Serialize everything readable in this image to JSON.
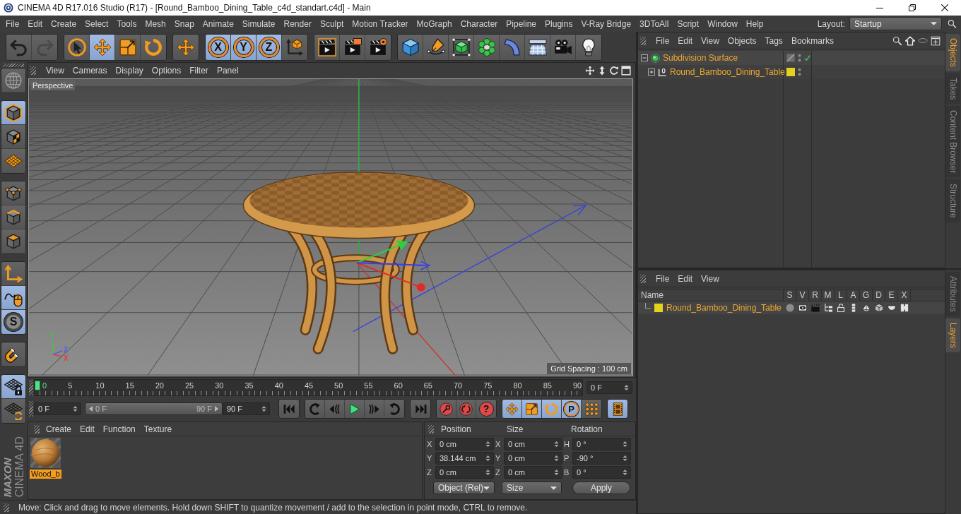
{
  "window": {
    "title": "CINEMA 4D R17.016 Studio (R17) - [Round_Bamboo_Dining_Table_c4d_standart.c4d] - Main"
  },
  "menubar": {
    "items": [
      "File",
      "Edit",
      "Create",
      "Select",
      "Tools",
      "Mesh",
      "Snap",
      "Animate",
      "Simulate",
      "Render",
      "Sculpt",
      "Motion Tracker",
      "MoGraph",
      "Character",
      "Pipeline",
      "Plugins",
      "V-Ray Bridge",
      "3DToAll",
      "Script",
      "Window",
      "Help"
    ],
    "layout_label": "Layout:",
    "layout_value": "Startup"
  },
  "toolbar": {
    "groups": [
      [
        {
          "on": false,
          "disabled": false
        },
        {
          "on": false,
          "disabled": true
        }
      ],
      [
        {
          "on": false,
          "disabled": false
        },
        {
          "on": true,
          "disabled": false
        },
        {
          "on": false,
          "disabled": false
        },
        {
          "on": false,
          "disabled": false
        }
      ],
      [
        {
          "on": false,
          "disabled": false
        }
      ],
      [
        {
          "label": "X",
          "on": true,
          "disabled": false
        },
        {
          "label": "Y",
          "on": true,
          "disabled": false
        },
        {
          "label": "Z",
          "on": true,
          "disabled": false
        },
        {
          "on": false,
          "disabled": false
        }
      ],
      [
        {
          "on": false,
          "disabled": false
        },
        {
          "on": false,
          "disabled": false
        },
        {
          "on": false,
          "disabled": false
        }
      ],
      [
        {
          "on": false,
          "disabled": false
        },
        {
          "on": false,
          "disabled": false
        },
        {
          "on": false,
          "disabled": false
        },
        {
          "on": false,
          "disabled": false
        },
        {
          "on": false,
          "disabled": false
        },
        {
          "on": false,
          "disabled": false
        },
        {
          "on": false,
          "disabled": false
        },
        {
          "on": false,
          "disabled": false
        }
      ]
    ]
  },
  "tool_strip": {
    "groups": [
      [
        {
          "on": false
        }
      ],
      [
        {
          "on": true
        },
        {
          "on": false
        },
        {
          "on": false
        }
      ],
      [
        {
          "on": false
        },
        {
          "on": false
        },
        {
          "on": false
        }
      ],
      [
        {
          "on": false
        },
        {
          "on": true
        },
        {
          "label": "S",
          "on": true
        }
      ],
      [
        {
          "on": false
        }
      ],
      [
        {
          "on": true
        },
        {
          "on": false
        }
      ]
    ]
  },
  "viewport": {
    "menu": [
      "View",
      "Cameras",
      "Display",
      "Options",
      "Filter",
      "Panel"
    ],
    "camera": "Perspective",
    "grid_spacing": "Grid Spacing : 100 cm",
    "axis_labels": [
      {
        "label": "Y",
        "color": "#3cc83c"
      },
      {
        "label": "Z",
        "color": "#4d5cf2"
      },
      {
        "label": "X",
        "color": "#e04040"
      }
    ]
  },
  "timeline": {
    "labels": [
      "0",
      "5",
      "10",
      "15",
      "20",
      "25",
      "30",
      "35",
      "40",
      "45",
      "50",
      "55",
      "60",
      "65",
      "70",
      "75",
      "80",
      "85",
      "90"
    ],
    "level": 0,
    "current_frame": "0 F"
  },
  "transport": {
    "start_field": "0 F",
    "range": {
      "start": "0 F",
      "end": "90 F",
      "level": 1
    },
    "end_field": "90 F",
    "groups": [
      [
        {
          "on": false
        }
      ],
      [
        {
          "on": false
        },
        {
          "on": false
        },
        {
          "on": false
        },
        {
          "on": false
        },
        {
          "on": false
        }
      ],
      [
        {
          "on": false
        }
      ],
      [
        {
          "on": false
        },
        {
          "on": false
        },
        {
          "label": "?",
          "on": false
        }
      ],
      [
        {
          "on": true
        },
        {
          "on": true
        },
        {
          "on": true
        },
        {
          "label": "P",
          "on": true
        },
        {
          "on": false
        }
      ],
      [
        {
          "on": true
        }
      ]
    ]
  },
  "material_manager": {
    "menu": [
      "Create",
      "Edit",
      "Function",
      "Texture"
    ],
    "materials": [
      {
        "name": "Wood_b",
        "selected": true
      }
    ]
  },
  "coordinates": {
    "headers": [
      "Position",
      "Size",
      "Rotation"
    ],
    "rows": [
      [
        {
          "axis": "X",
          "value": "0 cm"
        },
        {
          "axis": "X",
          "value": "0 cm"
        },
        {
          "axis": "H",
          "value": "0 °"
        }
      ],
      [
        {
          "axis": "Y",
          "value": "38.144 cm"
        },
        {
          "axis": "Y",
          "value": "0 cm"
        },
        {
          "axis": "P",
          "value": "-90 °"
        }
      ],
      [
        {
          "axis": "Z",
          "value": "0 cm"
        },
        {
          "axis": "Z",
          "value": "0 cm"
        },
        {
          "axis": "B",
          "value": "0 °"
        }
      ]
    ],
    "mode": "Object (Rel)",
    "size_mode": "Size",
    "apply": "Apply"
  },
  "logo": {
    "brand": "MAXON",
    "product": "CINEMA 4D"
  },
  "status_bar": {
    "text": "Move: Click and drag to move elements. Hold down SHIFT to quantize movement / add to the selection in point mode, CTRL to remove."
  },
  "object_manager": {
    "menu": [
      "File",
      "Edit",
      "View",
      "Objects",
      "Tags",
      "Bookmarks"
    ],
    "objects": [
      {
        "name": "Subdivision Surface",
        "kind": "generator",
        "expanded": true,
        "selected": true,
        "checked": true,
        "children": [
          {
            "name": "Round_Bamboo_Dining_Table",
            "kind": "null",
            "expanded": false,
            "selected": true,
            "checked": false,
            "color": "#e2d31c"
          }
        ]
      }
    ]
  },
  "side_tabs_top": [
    {
      "label": "Objects",
      "selected": true
    },
    {
      "label": "Takes",
      "selected": false
    },
    {
      "label": "Content Browser",
      "selected": false
    },
    {
      "label": "Structure",
      "selected": false
    }
  ],
  "layer_manager": {
    "menu": [
      "File",
      "Edit",
      "View"
    ],
    "columns": [
      "Name",
      "S",
      "V",
      "R",
      "M",
      "L",
      "A",
      "G",
      "D",
      "E",
      "X"
    ],
    "layers": [
      {
        "name": "Round_Bamboo_Dining_Table",
        "color": "#e2d31c",
        "selected": true,
        "solo": false,
        "visible": true,
        "render": true,
        "manager": true,
        "locked": false,
        "animation": true,
        "generators": true,
        "deformers": true,
        "expressions": true,
        "xref": true
      }
    ]
  },
  "side_tabs_bottom": [
    {
      "label": "Attributes",
      "selected": false
    },
    {
      "label": "Layers",
      "selected": true
    }
  ]
}
